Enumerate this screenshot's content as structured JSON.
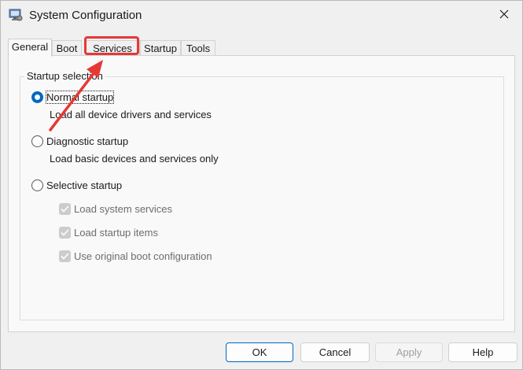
{
  "window": {
    "title": "System Configuration"
  },
  "tabs": [
    {
      "label": "General",
      "active": true
    },
    {
      "label": "Boot",
      "active": false
    },
    {
      "label": "Services",
      "active": false,
      "highlighted": true
    },
    {
      "label": "Startup",
      "active": false
    },
    {
      "label": "Tools",
      "active": false
    }
  ],
  "group": {
    "legend": "Startup selection"
  },
  "options": {
    "normal": {
      "label": "Normal startup",
      "description": "Load all device drivers and services",
      "checked": true
    },
    "diagnostic": {
      "label": "Diagnostic startup",
      "description": "Load basic devices and services only",
      "checked": false
    },
    "selective": {
      "label": "Selective startup",
      "checked": false
    }
  },
  "selective_items": [
    {
      "label": "Load system services",
      "checked": true,
      "enabled": false
    },
    {
      "label": "Load startup items",
      "checked": true,
      "enabled": false
    },
    {
      "label": "Use original boot configuration",
      "checked": true,
      "enabled": false
    }
  ],
  "buttons": {
    "ok": "OK",
    "cancel": "Cancel",
    "apply": "Apply",
    "help": "Help"
  },
  "annotation": {
    "color": "#e53935"
  },
  "accent": "#0067c0"
}
